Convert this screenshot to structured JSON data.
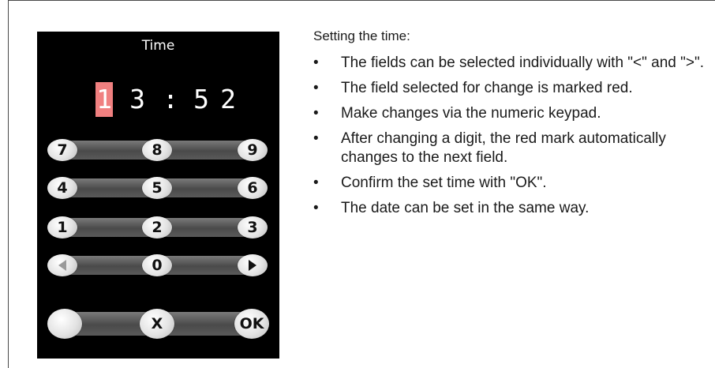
{
  "device": {
    "title": "Time",
    "time_digits": [
      "1",
      "3",
      ":",
      "5",
      "2"
    ],
    "selected_digit_index": 0,
    "keypad": [
      [
        "7",
        "8",
        "9"
      ],
      [
        "4",
        "5",
        "6"
      ],
      [
        "1",
        "2",
        "3"
      ],
      [
        "left-arrow-icon",
        "0",
        "right-arrow-icon"
      ],
      [
        "",
        "X",
        "OK"
      ]
    ]
  },
  "instructions": {
    "intro": "Setting the time:",
    "bullets": [
      "The fields can be selected individually with \"<\" and \">\".",
      "The field selected for change is marked red.",
      "Make changes via the numeric keypad.",
      "After changing a digit, the red mark automatically changes to the next field.",
      "Confirm the set time with \"OK\".",
      "The date can be set in the same way."
    ]
  },
  "colors": {
    "selection": "#f08080",
    "device_background": "#000000"
  }
}
